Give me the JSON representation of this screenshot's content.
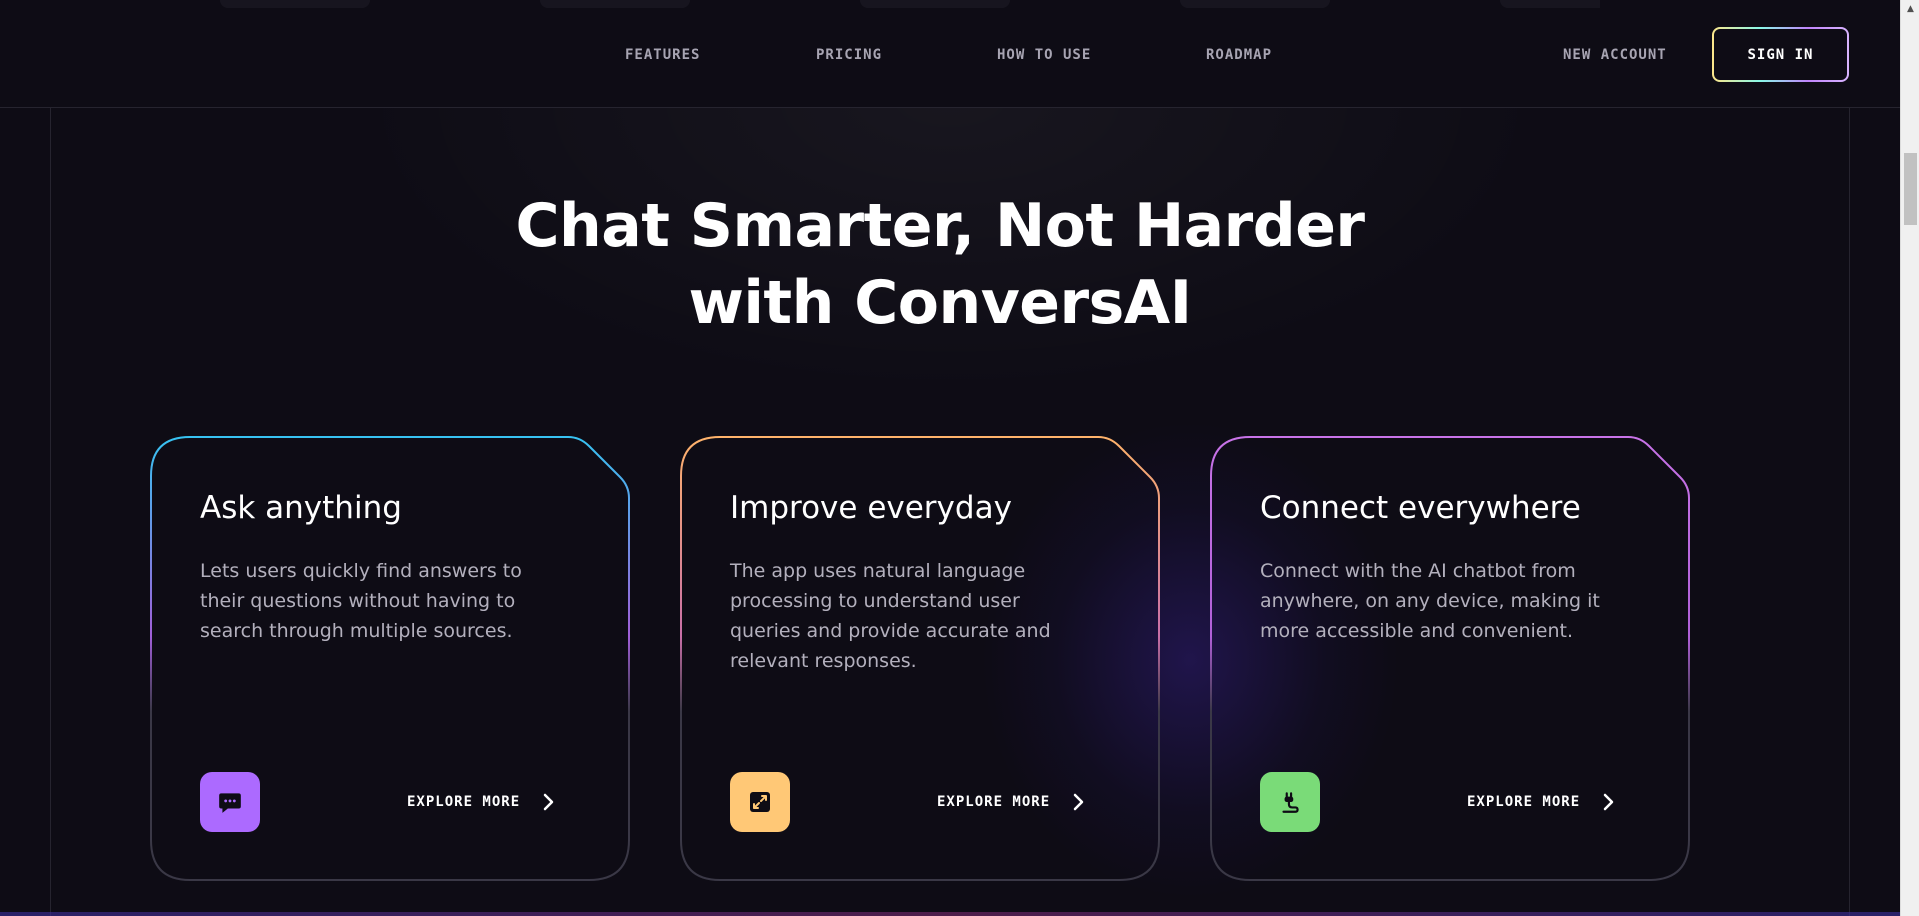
{
  "nav": {
    "links": [
      "FEATURES",
      "PRICING",
      "HOW TO USE",
      "ROADMAP"
    ],
    "new_account": "NEW ACCOUNT",
    "sign_in": "SIGN IN"
  },
  "hero": {
    "line1": "Chat Smarter, Not Harder",
    "line2": "with ConversAI"
  },
  "cards": [
    {
      "title": "Ask anything",
      "description": "Lets users quickly find answers to their questions without having to search through multiple sources.",
      "icon": "chat-bubble-icon",
      "icon_color": "#ac6aff",
      "border_color": "#37c3f2",
      "explore": "EXPLORE MORE"
    },
    {
      "title": "Improve everyday",
      "description": "The app uses natural language processing to understand user queries and provide accurate and relevant responses.",
      "icon": "expand-arrows-icon",
      "icon_color": "#ffc876",
      "border_color": "#ffb36b",
      "explore": "EXPLORE MORE"
    },
    {
      "title": "Connect everywhere",
      "description": "Connect with the AI chatbot from anywhere, on any device, making it more accessible and convenient.",
      "icon": "plug-icon",
      "icon_color": "#7adb78",
      "border_color": "#c873e8",
      "explore": "EXPLORE MORE"
    }
  ]
}
